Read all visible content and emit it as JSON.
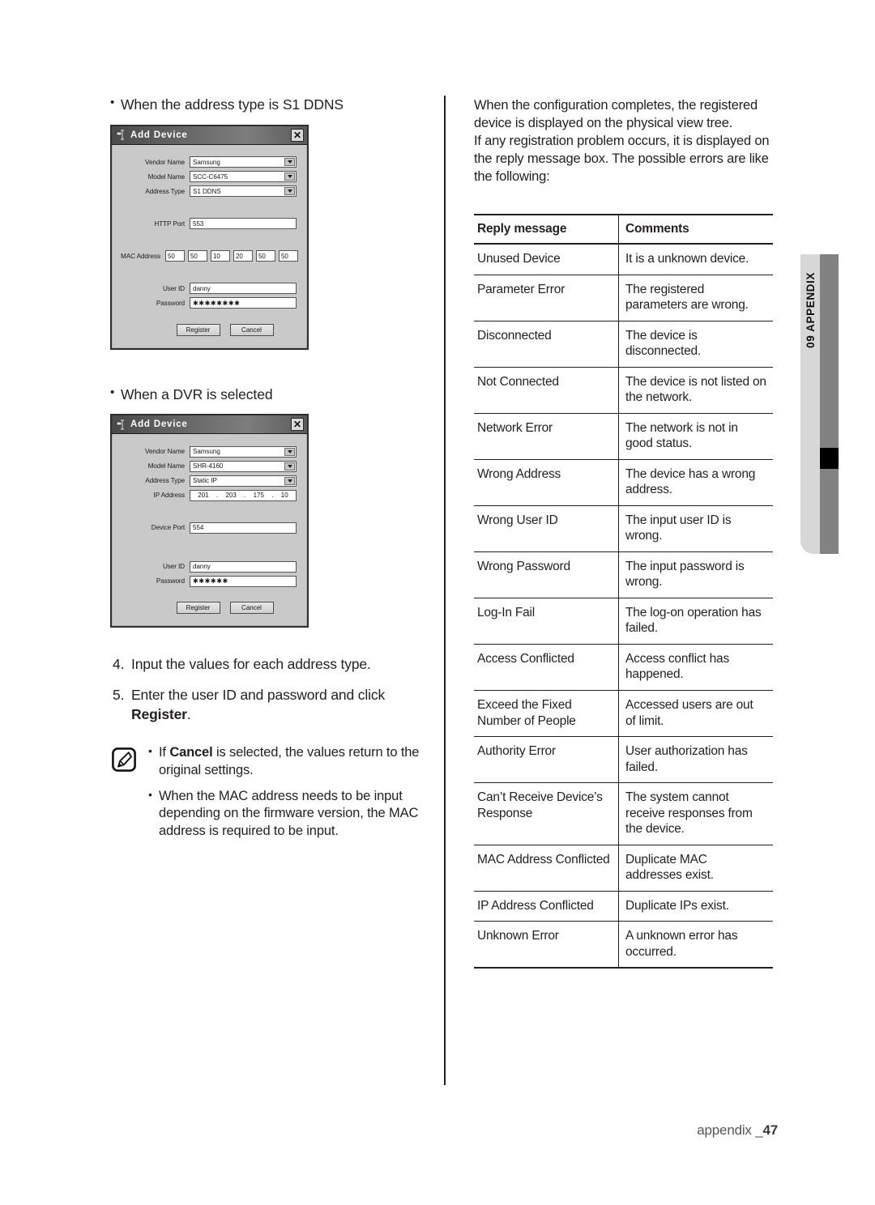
{
  "left_column": {
    "section1_heading": "When the address type is S1 DDNS",
    "section2_heading": "When a DVR is selected",
    "dialog_s1ddns": {
      "title": "Add Device",
      "close_label": "✕",
      "fields": {
        "vendor_name_label": "Vendor Name",
        "vendor_name_value": "Samsung",
        "model_name_label": "Model Name",
        "model_name_value": "SCC-C6475",
        "address_type_label": "Address Type",
        "address_type_value": "S1 DDNS",
        "http_port_label": "HTTP Port",
        "http_port_value": "553",
        "mac_address_label": "MAC Address",
        "mac_octets": [
          "50",
          "50",
          "10",
          "20",
          "50",
          "50"
        ],
        "user_id_label": "User ID",
        "user_id_value": "danny",
        "password_label": "Password",
        "password_value": "✱✱✱✱✱✱✱✱"
      },
      "register_button": "Register",
      "cancel_button": "Cancel"
    },
    "dialog_dvr": {
      "title": "Add Device",
      "close_label": "✕",
      "fields": {
        "vendor_name_label": "Vendor Name",
        "vendor_name_value": "Samsung",
        "model_name_label": "Model Name",
        "model_name_value": "SHR-4160",
        "address_type_label": "Address Type",
        "address_type_value": "Static IP",
        "ip_address_label": "IP Address",
        "ip_octets": [
          "201",
          "203",
          "175",
          "10"
        ],
        "ip_separator": ".",
        "device_port_label": "Device Port",
        "device_port_value": "554",
        "user_id_label": "User ID",
        "user_id_value": "danny",
        "password_label": "Password",
        "password_value": "✱✱✱✱✱✱"
      },
      "register_button": "Register",
      "cancel_button": "Cancel"
    },
    "steps": [
      {
        "num": "4.",
        "text": "Input the values for each address type."
      }
    ],
    "step5": {
      "num": "5.",
      "text_before": "Enter the user ID and password and click ",
      "bold": "Register",
      "text_after": "."
    },
    "note": {
      "item1_before": "If ",
      "item1_bold": "Cancel",
      "item1_after": " is selected, the values return to the original settings.",
      "item2": "When the MAC address needs to be input depending on the firmware version, the MAC address is required to be input."
    }
  },
  "right_column": {
    "intro": "When the configuration completes, the registered device is displayed on the physical view tree.\nIf any registration problem occurs, it is displayed on the reply message box. The possible errors are like the following:",
    "table": {
      "headers": [
        "Reply message",
        "Comments"
      ],
      "rows": [
        [
          "Unused Device",
          "It is a unknown device."
        ],
        [
          "Parameter Error",
          "The registered parameters are wrong."
        ],
        [
          "Disconnected",
          "The device is disconnected."
        ],
        [
          "Not Connected",
          "The device is not listed on the network."
        ],
        [
          "Network Error",
          "The network is not in good status."
        ],
        [
          "Wrong Address",
          "The device has a wrong address."
        ],
        [
          "Wrong User ID",
          "The input user ID is wrong."
        ],
        [
          "Wrong Password",
          "The input password is wrong."
        ],
        [
          "Log-In Fail",
          "The log-on operation has failed."
        ],
        [
          "Access Conflicted",
          "Access conflict has happened."
        ],
        [
          "Exceed the Fixed Number of People",
          "Accessed users are out of limit."
        ],
        [
          "Authority Error",
          "User authorization has failed."
        ],
        [
          "Can’t Receive Device’s Response",
          "The system cannot receive responses from the device."
        ],
        [
          "MAC Address Conflicted",
          "Duplicate MAC addresses exist."
        ],
        [
          "IP Address Conflicted",
          "Duplicate IPs exist."
        ],
        [
          "Unknown Error",
          "A unknown error has occurred."
        ]
      ]
    }
  },
  "side_tab": {
    "label": "09 APPENDIX",
    "light_color": "#d7d7d7",
    "dark_color": "#828282",
    "marker_color": "#000000"
  },
  "footer": {
    "text": "appendix _",
    "page_number": "47"
  }
}
